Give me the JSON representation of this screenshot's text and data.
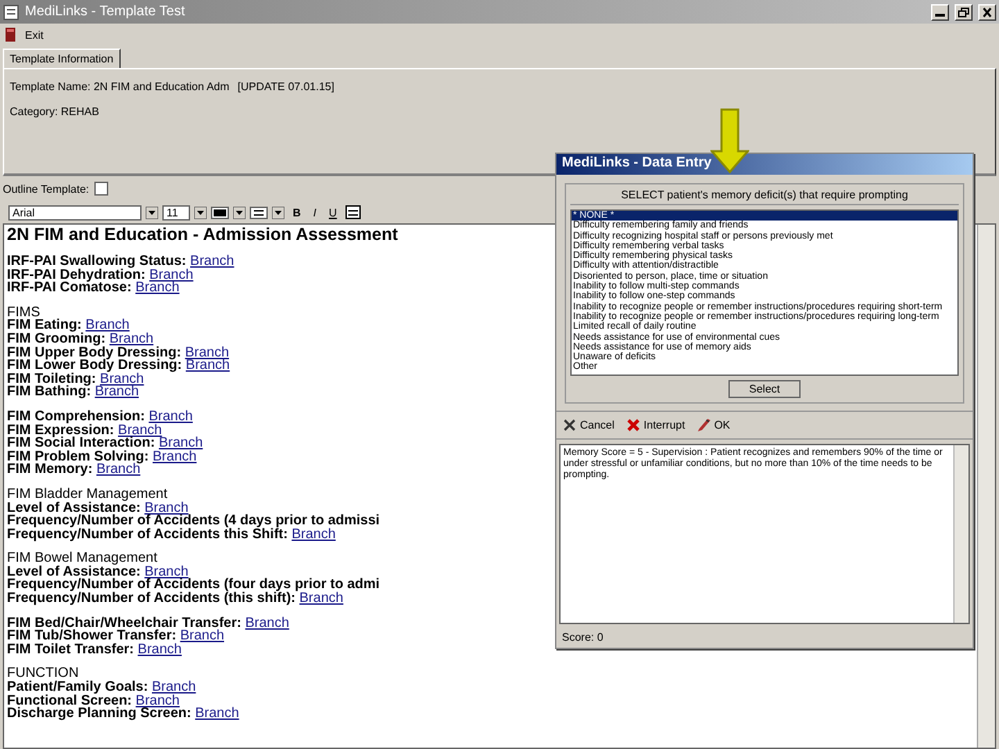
{
  "window": {
    "title": "MediLinks - Template Test"
  },
  "menu": [
    {
      "label": "Exit"
    }
  ],
  "tabs": [
    {
      "label": "Template Information",
      "selected": true
    }
  ],
  "template_info": {
    "name_label": "Template Name:",
    "name_value": "2N FIM and Education Adm",
    "update": "[UPDATE 07.01.15]",
    "category_label": "Category:",
    "category_value": "REHAB"
  },
  "outline_template": {
    "label": "Outline Template:",
    "checked": false
  },
  "toolbar": {
    "font": "Arial",
    "size": "11",
    "format_buttons": [
      "B",
      "I",
      "U"
    ]
  },
  "document": {
    "title": "2N FIM and Education - Admission Assessment",
    "sections": [
      {
        "lines": [
          {
            "label": "IRF-PAI Swallowing Status:",
            "link": "Branch"
          },
          {
            "label": "IRF-PAI Dehydration:",
            "link": "Branch"
          },
          {
            "label": "IRF-PAI Comatose:",
            "link": "Branch"
          }
        ]
      },
      {
        "heading": "FIMS",
        "lines": [
          {
            "label": "FIM Eating:",
            "link": "Branch"
          },
          {
            "label": "FIM Grooming:",
            "link": "Branch"
          },
          {
            "label": "FIM Upper Body Dressing:",
            "link": "Branch"
          },
          {
            "label": "FIM Lower Body Dressing:",
            "link": "Branch"
          },
          {
            "label": "FIM Toileting:",
            "link": "Branch"
          },
          {
            "label": "FIM Bathing:",
            "link": "Branch"
          }
        ]
      },
      {
        "lines": [
          {
            "label": "FIM Comprehension:",
            "link": "Branch"
          },
          {
            "label": "FIM Expression:",
            "link": "Branch"
          },
          {
            "label": "FIM Social Interaction:",
            "link": "Branch"
          },
          {
            "label": "FIM Problem Solving:",
            "link": "Branch"
          },
          {
            "label": "FIM Memory:",
            "link": "Branch"
          }
        ]
      },
      {
        "heading": "FIM Bladder Management",
        "lines": [
          {
            "label": "Level of Assistance:",
            "link": "Branch"
          },
          {
            "label": "Frequency/Number of  Accidents (4 days prior to admissi"
          },
          {
            "label": "Frequency/Number of  Accidents this Shift:",
            "link": "Branch"
          }
        ]
      },
      {
        "heading": "FIM Bowel Management",
        "lines": [
          {
            "label": "Level of Assistance:",
            "link": "Branch"
          },
          {
            "label": "Frequency/Number of Accidents (four days prior to admi"
          },
          {
            "label": "Frequency/Number of Accidents  (this shift):",
            "link": "Branch"
          }
        ]
      },
      {
        "lines": [
          {
            "label": "FIM Bed/Chair/Wheelchair Transfer:",
            "link": "Branch"
          },
          {
            "label": "FIM Tub/Shower Transfer:",
            "link": "Branch"
          },
          {
            "label": "FIM Toilet Transfer:",
            "link": "Branch"
          }
        ]
      },
      {
        "heading": "FUNCTION",
        "lines": [
          {
            "label": "Patient/Family Goals:",
            "link": "Branch"
          },
          {
            "label": "Functional Screen:",
            "link": "Branch"
          },
          {
            "label": "Discharge Planning Screen:",
            "link": "Branch"
          }
        ]
      }
    ]
  },
  "dialog": {
    "title": "MediLinks - Data Entry",
    "prompt": "SELECT patient's memory deficit(s) that require prompting",
    "options": [
      {
        "label": "* NONE *",
        "selected": true
      },
      {
        "label": "Difficulty remembering family and friends",
        "selected": false
      },
      {
        "label": "Difficulty recognizing hospital staff or persons previously met",
        "selected": false
      },
      {
        "label": "Difficulty remembering verbal tasks",
        "selected": false
      },
      {
        "label": "Difficulty remembering physical tasks",
        "selected": false
      },
      {
        "label": "Difficulty with attention/distractible",
        "selected": false
      },
      {
        "label": "Disoriented to person, place, time or situation",
        "selected": false
      },
      {
        "label": "Inability to follow multi-step commands",
        "selected": false
      },
      {
        "label": "Inability to follow one-step commands",
        "selected": false
      },
      {
        "label": "Inability to recognize people or remember instructions/procedures requiring short-term",
        "selected": false
      },
      {
        "label": "Inability to recognize people or remember instructions/procedures requiring long-term",
        "selected": false
      },
      {
        "label": "Limited recall of daily routine",
        "selected": false
      },
      {
        "label": "Needs assistance for use of environmental cues",
        "selected": false
      },
      {
        "label": "Needs assistance for use of memory aids",
        "selected": false
      },
      {
        "label": "Unaware of deficits",
        "selected": false
      },
      {
        "label": "Other",
        "selected": false
      }
    ],
    "select_button": "Select",
    "actions": [
      {
        "kind": "cancel",
        "label": "Cancel"
      },
      {
        "kind": "interrupt",
        "label": "Interrupt"
      },
      {
        "kind": "ok",
        "label": "OK"
      }
    ],
    "note": "Memory Score = 5 - Supervision : Patient recognizes and remembers 90% of the time or under stressful or unfamiliar conditions, but no more than 10% of the time needs to be prompting.",
    "score": "Score: 0"
  }
}
